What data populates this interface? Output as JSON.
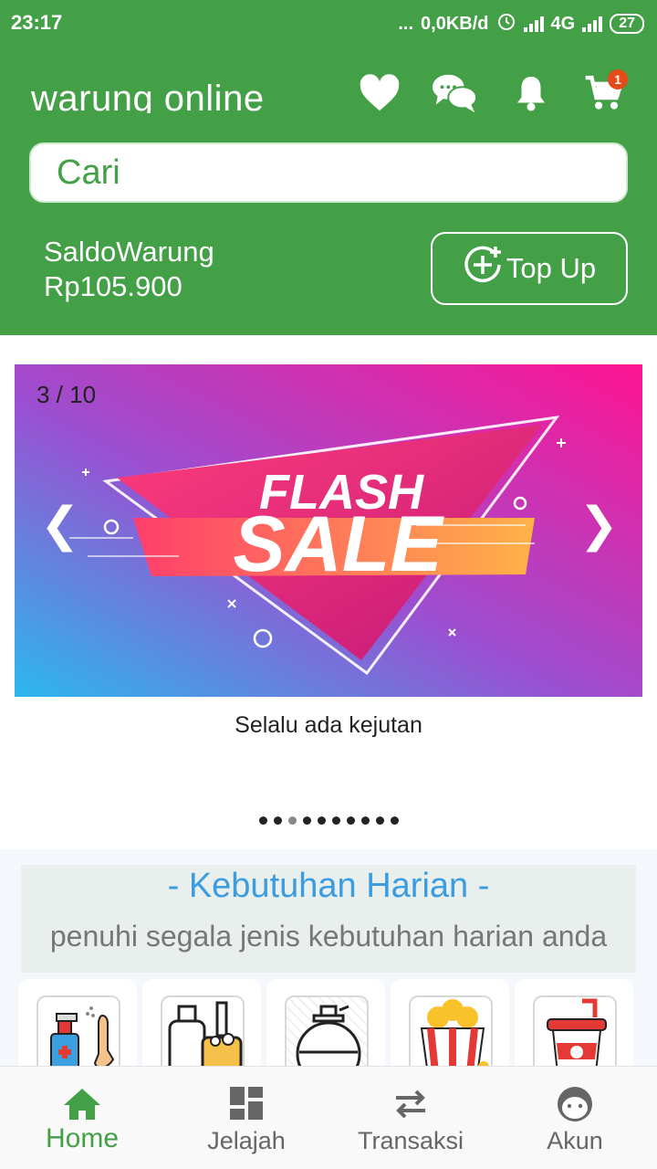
{
  "statusbar": {
    "time": "23:17",
    "dots": "...",
    "net_speed": "0,0KB/d",
    "network": "4G",
    "battery": "27"
  },
  "header": {
    "title": "warung online",
    "icons": [
      "heart-icon",
      "chat-icon",
      "bell-icon",
      "cart-icon"
    ],
    "cart_badge": "1",
    "search_placeholder": "Cari",
    "saldo_label": "SaldoWarung",
    "saldo_value": "Rp105.900",
    "topup_label": "Top Up"
  },
  "carousel": {
    "counter": "3 / 10",
    "banner_line1": "FLASH",
    "banner_line2": "SALE",
    "prev": "❮",
    "next": "❯",
    "caption": "Selalu ada kejutan",
    "total_slides": 10,
    "active_index": 2
  },
  "section": {
    "title": "- Kebutuhan Harian -",
    "subtitle": "penuhi segala jenis kebutuhan harian anda",
    "categories": [
      "sanitizer-icon",
      "cleaning-products-icon",
      "perfume-icon",
      "popcorn-icon",
      "drink-icon"
    ]
  },
  "bottom_nav": {
    "items": [
      {
        "label": "Home",
        "icon": "home-icon",
        "active": true
      },
      {
        "label": "Jelajah",
        "icon": "grid-icon",
        "active": false
      },
      {
        "label": "Transaksi",
        "icon": "swap-icon",
        "active": false
      },
      {
        "label": "Akun",
        "icon": "face-icon",
        "active": false
      }
    ]
  },
  "colors": {
    "primary": "#43a047",
    "section_title": "#3c9ce0",
    "badge": "#e64a19"
  }
}
